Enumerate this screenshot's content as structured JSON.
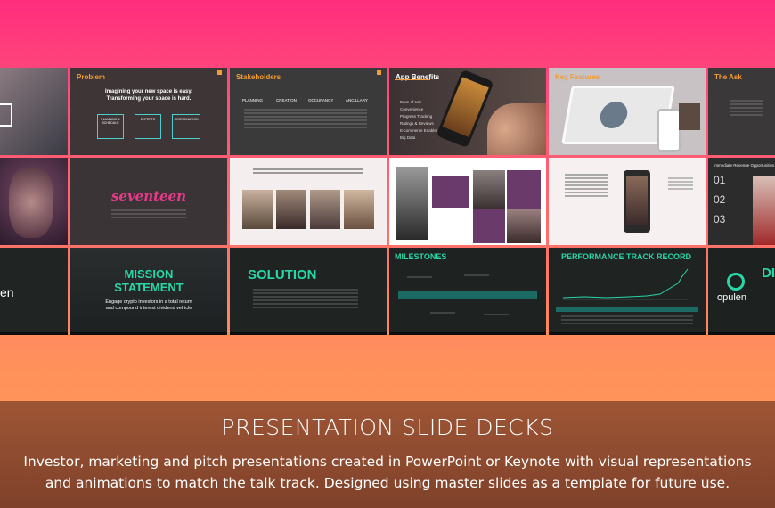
{
  "caption": {
    "title": "PRESENTATION SLIDE DECKS",
    "body": "Investor, marketing and pitch presentations created in PowerPoint or Keynote with visual representations and animations to match the talk track. Designed using master slides as a template for future use."
  },
  "slides": {
    "problem": {
      "title": "Problem",
      "line1": "Imagining your new space is easy.",
      "line2": "Transforming your space is hard.",
      "box1": "PLANNING & SCHEDULE",
      "box2": "EXPERTS",
      "box3": "COORDINATION"
    },
    "stakeholders": {
      "title": "Stakeholders",
      "cols": [
        "PLANNING",
        "CREATION",
        "OCCUPANCY",
        "ANCILLARY"
      ]
    },
    "app_benefits": {
      "title": "App Benefits",
      "bullets": [
        "Ease of Use",
        "Convenience",
        "Progress Tracking",
        "Ratings & Reviews",
        "E-commerce Enabler",
        "Big Data"
      ]
    },
    "key_features": {
      "title": "Key Features"
    },
    "the_ask": {
      "title": "The Ask"
    },
    "seventeen": {
      "logo": "seventeen"
    },
    "opportunities": {
      "heading": "Immediate Revenue Opportunities",
      "nums": [
        "01",
        "02",
        "03"
      ]
    },
    "mission": {
      "line1": "MISSION",
      "line2": "STATEMENT",
      "text": "Engage crypto investors in a total return and compound interest dividend vehicle"
    },
    "solution": {
      "title": "SOLUTION"
    },
    "milestones": {
      "title": "MILESTONES"
    },
    "performance": {
      "title": "PERFORMANCE TRACK RECORD"
    },
    "opulen": {
      "logo": "opulen",
      "partial": "DI"
    },
    "partial_left": {
      "text": "en"
    }
  },
  "colors": {
    "teal": "#29d6a6",
    "orange": "#f39c34",
    "pink": "#ff2d7d"
  }
}
